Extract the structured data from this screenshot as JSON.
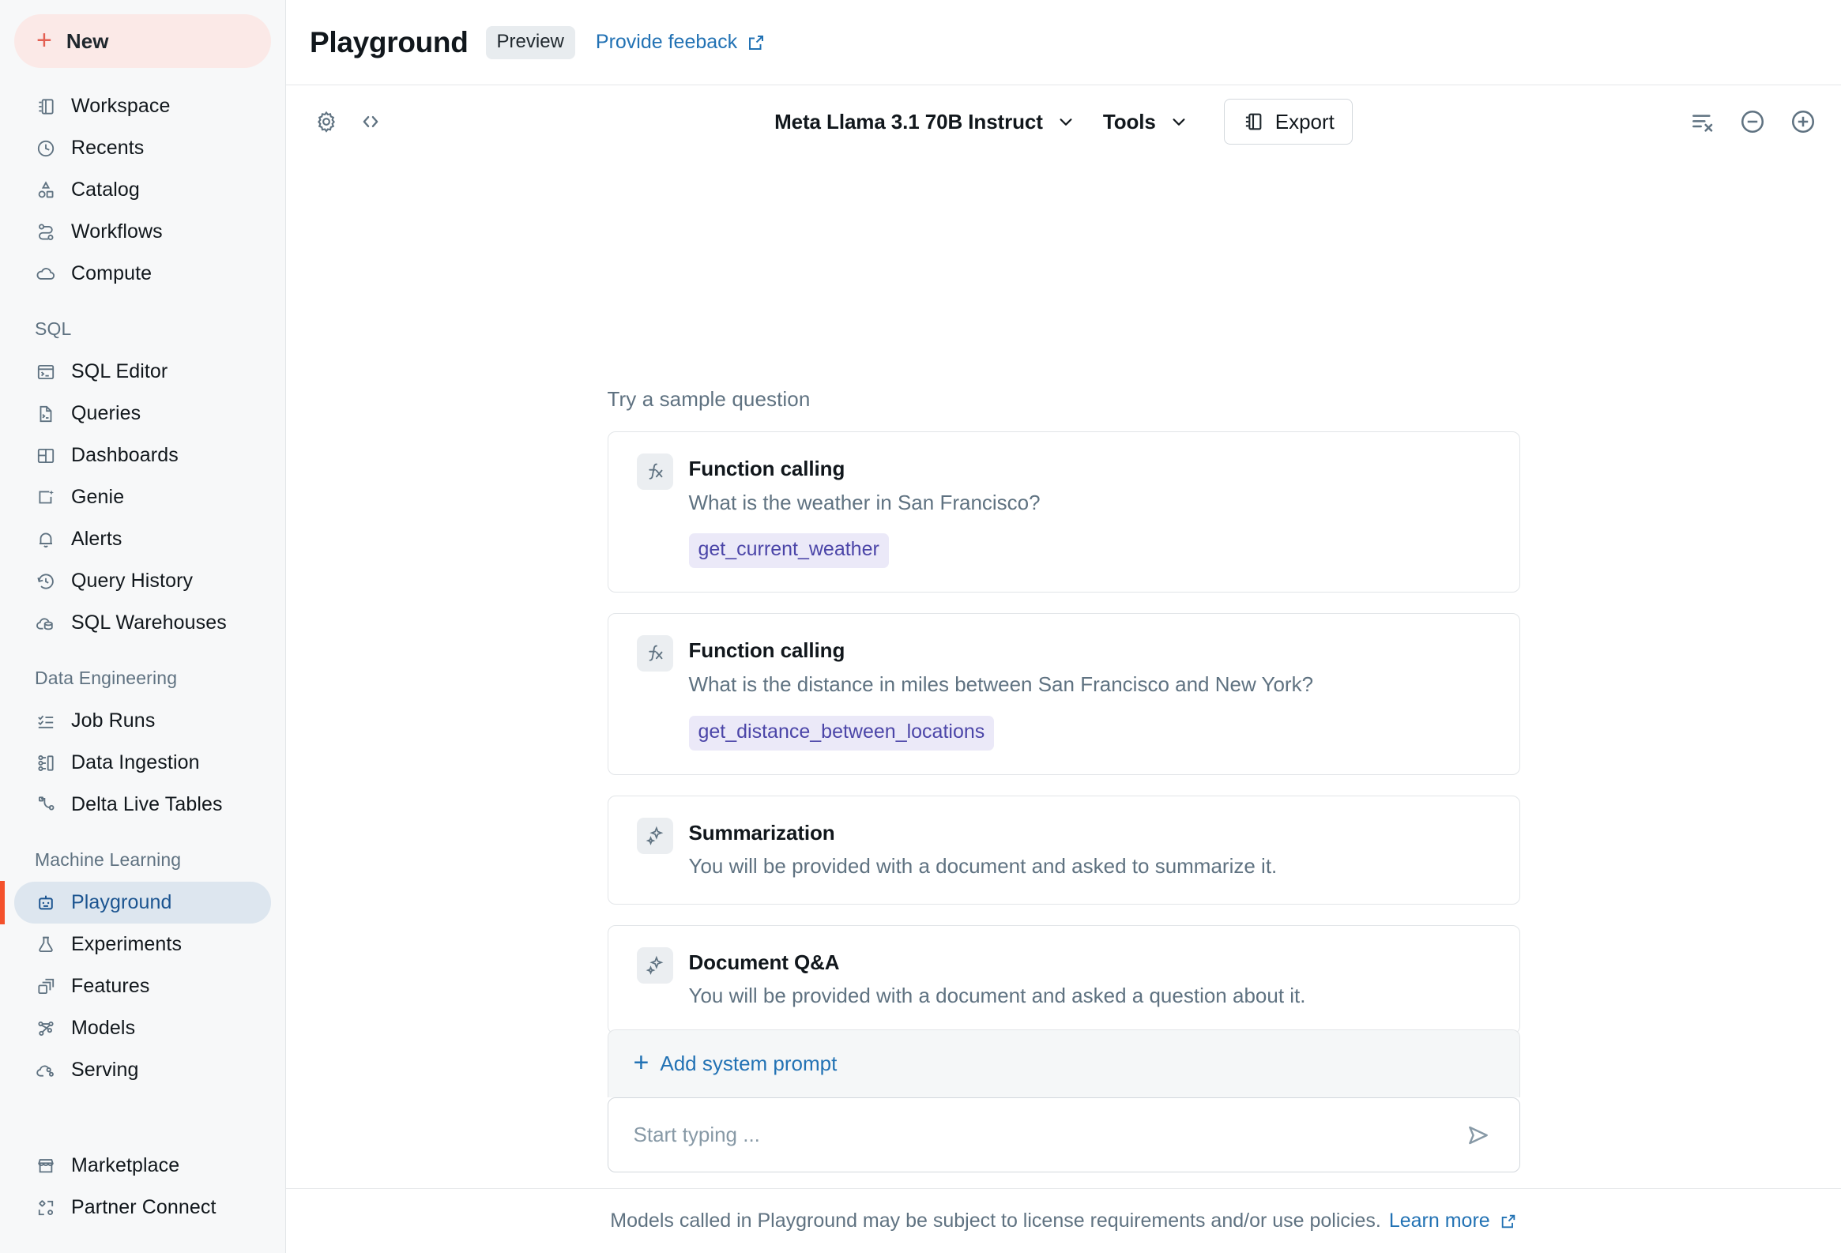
{
  "sidebar": {
    "new_button": {
      "label": "New",
      "icon": "plus-icon"
    },
    "top_items": [
      {
        "label": "Workspace",
        "icon": "workspace-icon"
      },
      {
        "label": "Recents",
        "icon": "clock-icon"
      },
      {
        "label": "Catalog",
        "icon": "catalog-icon"
      },
      {
        "label": "Workflows",
        "icon": "workflows-icon"
      },
      {
        "label": "Compute",
        "icon": "cloud-icon"
      }
    ],
    "groups": [
      {
        "label": "SQL",
        "items": [
          {
            "label": "SQL Editor",
            "icon": "sql-editor-icon"
          },
          {
            "label": "Queries",
            "icon": "queries-icon"
          },
          {
            "label": "Dashboards",
            "icon": "dashboards-icon"
          },
          {
            "label": "Genie",
            "icon": "genie-icon"
          },
          {
            "label": "Alerts",
            "icon": "bell-icon"
          },
          {
            "label": "Query History",
            "icon": "history-icon"
          },
          {
            "label": "SQL Warehouses",
            "icon": "warehouse-icon"
          }
        ]
      },
      {
        "label": "Data Engineering",
        "items": [
          {
            "label": "Job Runs",
            "icon": "job-runs-icon"
          },
          {
            "label": "Data Ingestion",
            "icon": "data-ingestion-icon"
          },
          {
            "label": "Delta Live Tables",
            "icon": "delta-live-tables-icon"
          }
        ]
      },
      {
        "label": "Machine Learning",
        "items": [
          {
            "label": "Playground",
            "icon": "robot-icon",
            "active": true
          },
          {
            "label": "Experiments",
            "icon": "experiments-icon"
          },
          {
            "label": "Features",
            "icon": "features-icon"
          },
          {
            "label": "Models",
            "icon": "models-icon"
          },
          {
            "label": "Serving",
            "icon": "serving-icon"
          }
        ]
      }
    ],
    "bottom_items": [
      {
        "label": "Marketplace",
        "icon": "marketplace-icon"
      },
      {
        "label": "Partner Connect",
        "icon": "partner-connect-icon"
      }
    ],
    "accent_color": "#F4512C",
    "active_bg": "#DDE6EF",
    "active_text": "#1B5490"
  },
  "header": {
    "title": "Playground",
    "badge": "Preview",
    "feedback_link": "Provide feeback",
    "feedback_icon": "external-link-icon"
  },
  "toolbar": {
    "settings_icon": "gear-icon",
    "code_icon": "code-brackets-icon",
    "model_select": "Meta Llama 3.1 70B Instruct",
    "tools_select": "Tools",
    "export_label": "Export",
    "export_icon": "notebook-icon",
    "right_icons": [
      {
        "name": "clear-all-icon"
      },
      {
        "name": "minus-circle-icon"
      },
      {
        "name": "plus-circle-icon"
      }
    ]
  },
  "main": {
    "samples_title": "Try a sample question",
    "cards": [
      {
        "title": "Function calling",
        "subtitle": "What is the weather in San Francisco?",
        "icon": "function-icon",
        "tag": "get_current_weather"
      },
      {
        "title": "Function calling",
        "subtitle": "What is the distance in miles between San Francisco and New York?",
        "icon": "function-icon",
        "tag": "get_distance_between_locations"
      },
      {
        "title": "Summarization",
        "subtitle": "You will be provided with a document and asked to summarize it.",
        "icon": "sparkle-icon",
        "tag": null
      },
      {
        "title": "Document Q&A",
        "subtitle": "You will be provided with a document and asked a question about it.",
        "icon": "sparkle-icon",
        "tag": null
      }
    ]
  },
  "composer": {
    "system_prompt_label": "Add system prompt",
    "system_prompt_icon": "plus-icon",
    "input_value": "",
    "input_placeholder": "Start typing ...",
    "send_icon": "send-icon"
  },
  "footer": {
    "text": "Models called in Playground may be subject to license requirements and/or use policies.",
    "link": "Learn more",
    "link_icon": "external-link-icon"
  },
  "colors": {
    "brand_red": "#F4512C",
    "link_blue": "#2272B4",
    "tag_bg": "#EBE9F8",
    "tag_text": "#4B45A8",
    "sidebar_bg": "#F7F8F9"
  }
}
